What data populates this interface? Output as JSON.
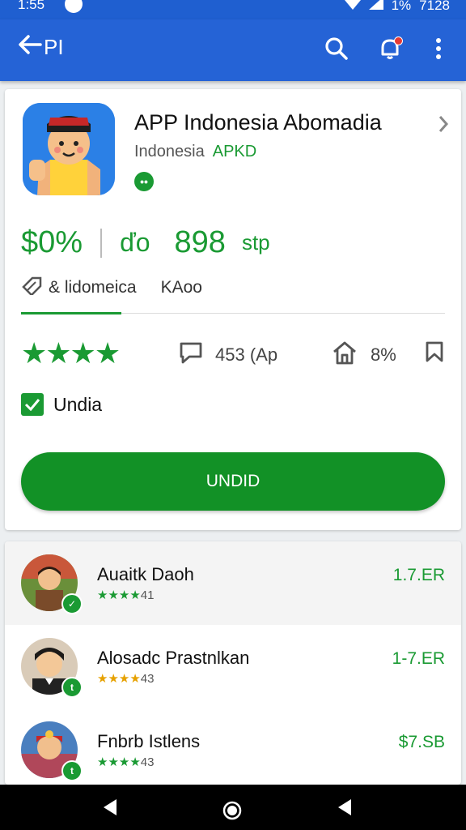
{
  "status_bar": {
    "time": "1:55",
    "right_text": "7128",
    "battery_text": "1%"
  },
  "app_bar": {
    "back_label": "PI"
  },
  "app": {
    "title": "APP Indonesia Abomadia",
    "subtitle": "Indonesia",
    "subtitle_green": "APKD",
    "stat_1": "$0%",
    "stat_2": "ďo",
    "stat_3": "898",
    "stat_4": "stp",
    "info_left": "& lidomeica",
    "info_right": "KAoo",
    "review_count": "453 (Ap",
    "install_count": "8%",
    "checkbox_label": "Undia",
    "install_button": "UNDID"
  },
  "list": [
    {
      "name": "Auaitk Daoh",
      "rating": "41",
      "value": "1.7.ER",
      "star_color": "green"
    },
    {
      "name": "Alosadc Prastnlkan",
      "rating": "43",
      "value": "1-7.ER",
      "star_color": "orange"
    },
    {
      "name": "Fnbrb Istlens",
      "rating": "43",
      "value": "$7.SB",
      "star_color": "green"
    }
  ],
  "colors": {
    "app_bar": "#2563d6",
    "accent_green": "#1a9a33",
    "button_green": "#129126"
  }
}
